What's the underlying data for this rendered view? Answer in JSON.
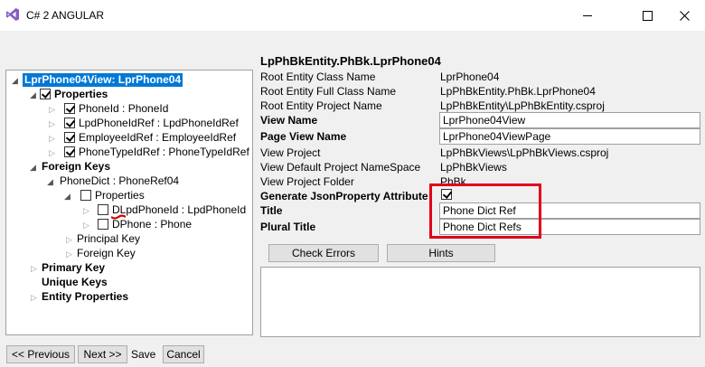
{
  "window": {
    "title": "C# 2 ANGULAR",
    "icon": "visual-studio-icon",
    "buttons": [
      "minimize-icon",
      "maximize-icon",
      "close-icon"
    ]
  },
  "tree": {
    "root": "LprPhone04View: LprPhone04",
    "properties": "Properties",
    "property_items": [
      "PhoneId : PhoneId",
      "LpdPhoneIdRef : LpdPhoneIdRef",
      "EmployeeIdRef : EmployeeIdRef",
      "PhoneTypeIdRef : PhoneTypeIdRef"
    ],
    "foreign_keys": "Foreign Keys",
    "phone_dict": "PhoneDict : PhoneRef04",
    "fk_properties": "Properties",
    "fk_items": [
      "DLpdPhoneId : LpdPhoneId",
      "DPhone : Phone"
    ],
    "principal_key": "Principal Key",
    "foreign_key": "Foreign Key",
    "primary_key": "Primary Key",
    "unique_keys": "Unique Keys",
    "entity_properties": "Entity Properties"
  },
  "details": {
    "title": "LpPhBkEntity.PhBk.LprPhone04",
    "root_entity_class_name": {
      "label": "Root Entity Class Name",
      "value": "LprPhone04"
    },
    "root_entity_full_class_name": {
      "label": "Root Entity Full Class Name",
      "value": "LpPhBkEntity.PhBk.LprPhone04"
    },
    "root_entity_project_name": {
      "label": "Root Entity Project Name",
      "value": "LpPhBkEntity\\LpPhBkEntity.csproj"
    },
    "view_name": {
      "label": "View Name",
      "value": "LprPhone04View"
    },
    "page_view_name": {
      "label": "Page View Name",
      "value": "LprPhone04ViewPage"
    },
    "view_project": {
      "label": "View Project",
      "value": "LpPhBkViews\\LpPhBkViews.csproj"
    },
    "view_default_namespace": {
      "label": "View Default Project NameSpace",
      "value": "LpPhBkViews"
    },
    "view_project_folder": {
      "label": "View Project Folder",
      "value": "PhBk"
    },
    "generate_json_property": {
      "label": "Generate JsonProperty Attribute",
      "checked": true
    },
    "title_field": {
      "label": "Title",
      "value": "Phone Dict Ref"
    },
    "plural_title_field": {
      "label": "Plural Title",
      "value": "Phone Dict Refs"
    },
    "highlight_color": "#e2001a"
  },
  "actions": {
    "check_errors": "Check Errors",
    "hints": "Hints",
    "previous": "<< Previous",
    "next": "Next >>",
    "save": "Save",
    "cancel": "Cancel"
  },
  "colors": {
    "selection": "#0078d7",
    "background": "#f0f0f0",
    "vs_purple": "#865fc5"
  }
}
